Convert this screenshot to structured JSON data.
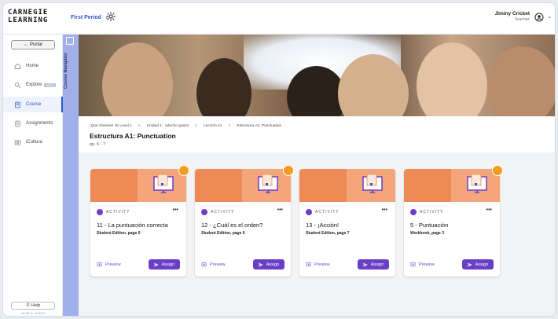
{
  "header": {
    "logo": "CARNEGIE LEARNING",
    "class_name": "First Period",
    "user_name": "Jiminy Cricket",
    "user_role": "Teacher"
  },
  "sidebar": {
    "portal": "← Portal",
    "items": [
      {
        "label": "Home",
        "icon": "home-icon"
      },
      {
        "label": "Explore",
        "badge": "BETA",
        "icon": "explore-icon"
      },
      {
        "label": "Course",
        "icon": "course-icon",
        "active": true
      },
      {
        "label": "Assignments",
        "icon": "assignments-icon"
      },
      {
        "label": "iCultura",
        "icon": "icultura-icon"
      }
    ],
    "help": "⓪ Help",
    "version": "v2.33.3 / v2.33.3"
  },
  "navigator": {
    "label": "Course Navigator"
  },
  "breadcrumb": [
    "¡Qué chévere! 3e Level 1",
    "Unidad 1 : ¡Mucho gusto!",
    "Lección A1",
    "Estructura A1: Punctuation"
  ],
  "page": {
    "title": "Estructura A1: Punctuation",
    "pages": "pp. 6 - 7"
  },
  "cards": [
    {
      "type": "ACTIVITY",
      "title": "11 - La puntuación correcta",
      "subtitle": "Student Edition, page 6",
      "preview": "Preview",
      "assign": "Assign"
    },
    {
      "type": "ACTIVITY",
      "title": "12 - ¿Cuál es el orden?",
      "subtitle": "Student Edition, page 6",
      "preview": "Preview",
      "assign": "Assign"
    },
    {
      "type": "ACTIVITY",
      "title": "13 - ¡Acción!",
      "subtitle": "Student Edition, page 7",
      "preview": "Preview",
      "assign": "Assign"
    },
    {
      "type": "ACTIVITY",
      "title": "5 - Puntuación",
      "subtitle": "Workbook, page 3",
      "preview": "Preview",
      "assign": "Assign"
    }
  ],
  "colors": {
    "accent": "#6a3fc8",
    "brand_blue": "#2e54c8",
    "card_image": "#ee8a55",
    "badge": "#f39c21",
    "navigator": "#9fb0ea"
  }
}
